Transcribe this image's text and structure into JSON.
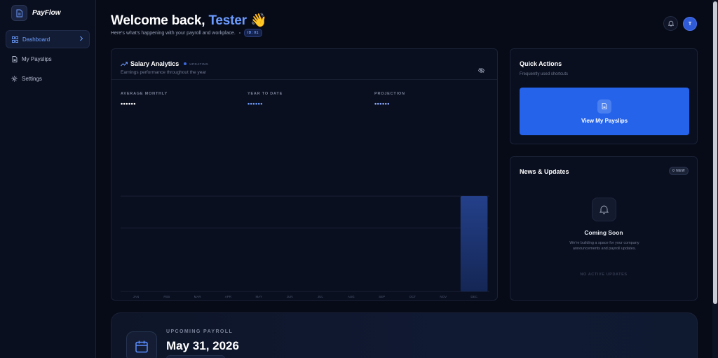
{
  "brand": {
    "name": "PayFlow"
  },
  "sidebar": {
    "items": [
      {
        "label": "Dashboard",
        "active": true,
        "icon": "grid-icon"
      },
      {
        "label": "My Payslips",
        "active": false,
        "icon": "document-icon"
      },
      {
        "label": "Settings",
        "active": false,
        "icon": "gear-icon"
      }
    ]
  },
  "header": {
    "greeting": "Welcome back,",
    "user_name": "Tester",
    "wave": "👋",
    "subtitle": "Here's what's happening with your payroll and workplace.",
    "id_badge": "ID: 01",
    "avatar_initial": "T"
  },
  "analytics": {
    "title": "Salary Analytics",
    "status": "UPDATING",
    "subtitle": "Earnings performance throughout the year",
    "stats": [
      {
        "label": "AVERAGE MONTHLY",
        "value": "••••••",
        "color": "#ffffff"
      },
      {
        "label": "YEAR TO DATE",
        "value": "••••••",
        "color": "#6f9dff"
      },
      {
        "label": "PROJECTION",
        "value": "••••••",
        "color": "#8aa8ff"
      }
    ]
  },
  "chart_data": {
    "type": "bar",
    "categories": [
      "JAN",
      "FEB",
      "MAR",
      "APR",
      "MAY",
      "JUN",
      "JUL",
      "AUG",
      "SEP",
      "OCT",
      "NOV",
      "DEC"
    ],
    "values": [
      0,
      0,
      0,
      0,
      0,
      0,
      0,
      0,
      0,
      0,
      0,
      1
    ],
    "ylim": [
      0,
      1
    ],
    "grid": true,
    "bar_color": "#24408a"
  },
  "quick_actions": {
    "title": "Quick Actions",
    "subtitle": "Frequently used shortcuts",
    "button_label": "View My Payslips"
  },
  "news": {
    "title": "News & Updates",
    "badge": "0 NEW",
    "heading": "Coming Soon",
    "description": "We're building a space for your company announcements and payroll updates.",
    "empty": "NO ACTIVE UPDATES"
  },
  "payroll": {
    "label": "UPCOMING PAYROLL",
    "date": "May 31, 2026"
  },
  "colors": {
    "accent": "#2563eb",
    "highlight": "#6c9bff",
    "background": "#070b18"
  }
}
